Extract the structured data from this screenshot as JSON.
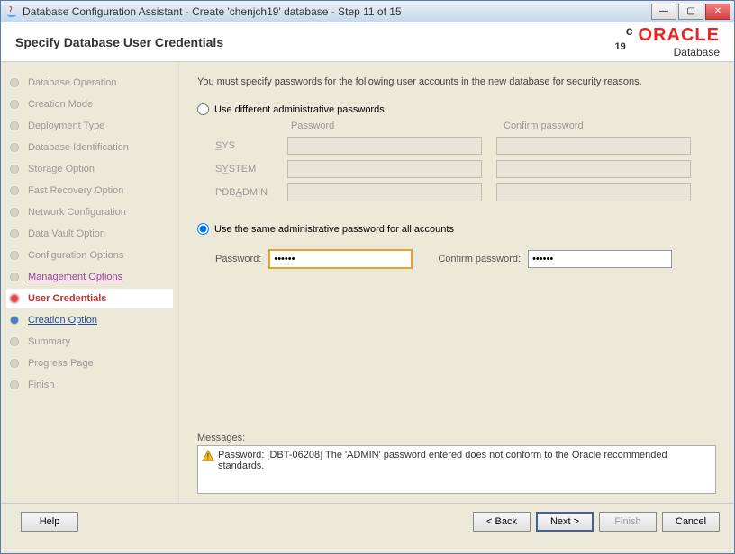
{
  "window": {
    "title": "Database Configuration Assistant - Create 'chenjch19' database - Step 11 of 15"
  },
  "header": {
    "title": "Specify Database User Credentials",
    "brand_version": "19",
    "brand_suffix": "c",
    "brand_name": "ORACLE",
    "brand_sub": "Database"
  },
  "sidebar": {
    "items": [
      {
        "label": "Database Operation",
        "state": "completed"
      },
      {
        "label": "Creation Mode",
        "state": "completed"
      },
      {
        "label": "Deployment Type",
        "state": "completed"
      },
      {
        "label": "Database Identification",
        "state": "completed"
      },
      {
        "label": "Storage Option",
        "state": "completed"
      },
      {
        "label": "Fast Recovery Option",
        "state": "completed"
      },
      {
        "label": "Network Configuration",
        "state": "completed"
      },
      {
        "label": "Data Vault Option",
        "state": "completed"
      },
      {
        "label": "Configuration Options",
        "state": "completed"
      },
      {
        "label": "Management Options",
        "state": "link"
      },
      {
        "label": "User Credentials",
        "state": "current"
      },
      {
        "label": "Creation Option",
        "state": "next"
      },
      {
        "label": "Summary",
        "state": "pending"
      },
      {
        "label": "Progress Page",
        "state": "pending"
      },
      {
        "label": "Finish",
        "state": "pending"
      }
    ]
  },
  "main": {
    "instruction": "You must specify passwords for the following user accounts in the new database for security reasons.",
    "radio1": "Use different administrative passwords",
    "col_password": "Password",
    "col_confirm": "Confirm password",
    "rows": {
      "sys": "SYS",
      "system": "SYSTEM",
      "pdbadmin": "PDBADMIN"
    },
    "radio2": "Use the same administrative password for all accounts",
    "password_label": "Password:",
    "confirm_label": "Confirm password:",
    "password_value": "••••••",
    "confirm_value": "••••••",
    "messages_label": "Messages:",
    "message_text": "Password: [DBT-06208] The 'ADMIN' password entered does not conform to the Oracle recommended standards."
  },
  "footer": {
    "help": "Help",
    "back": "< Back",
    "next": "Next >",
    "finish": "Finish",
    "cancel": "Cancel"
  }
}
